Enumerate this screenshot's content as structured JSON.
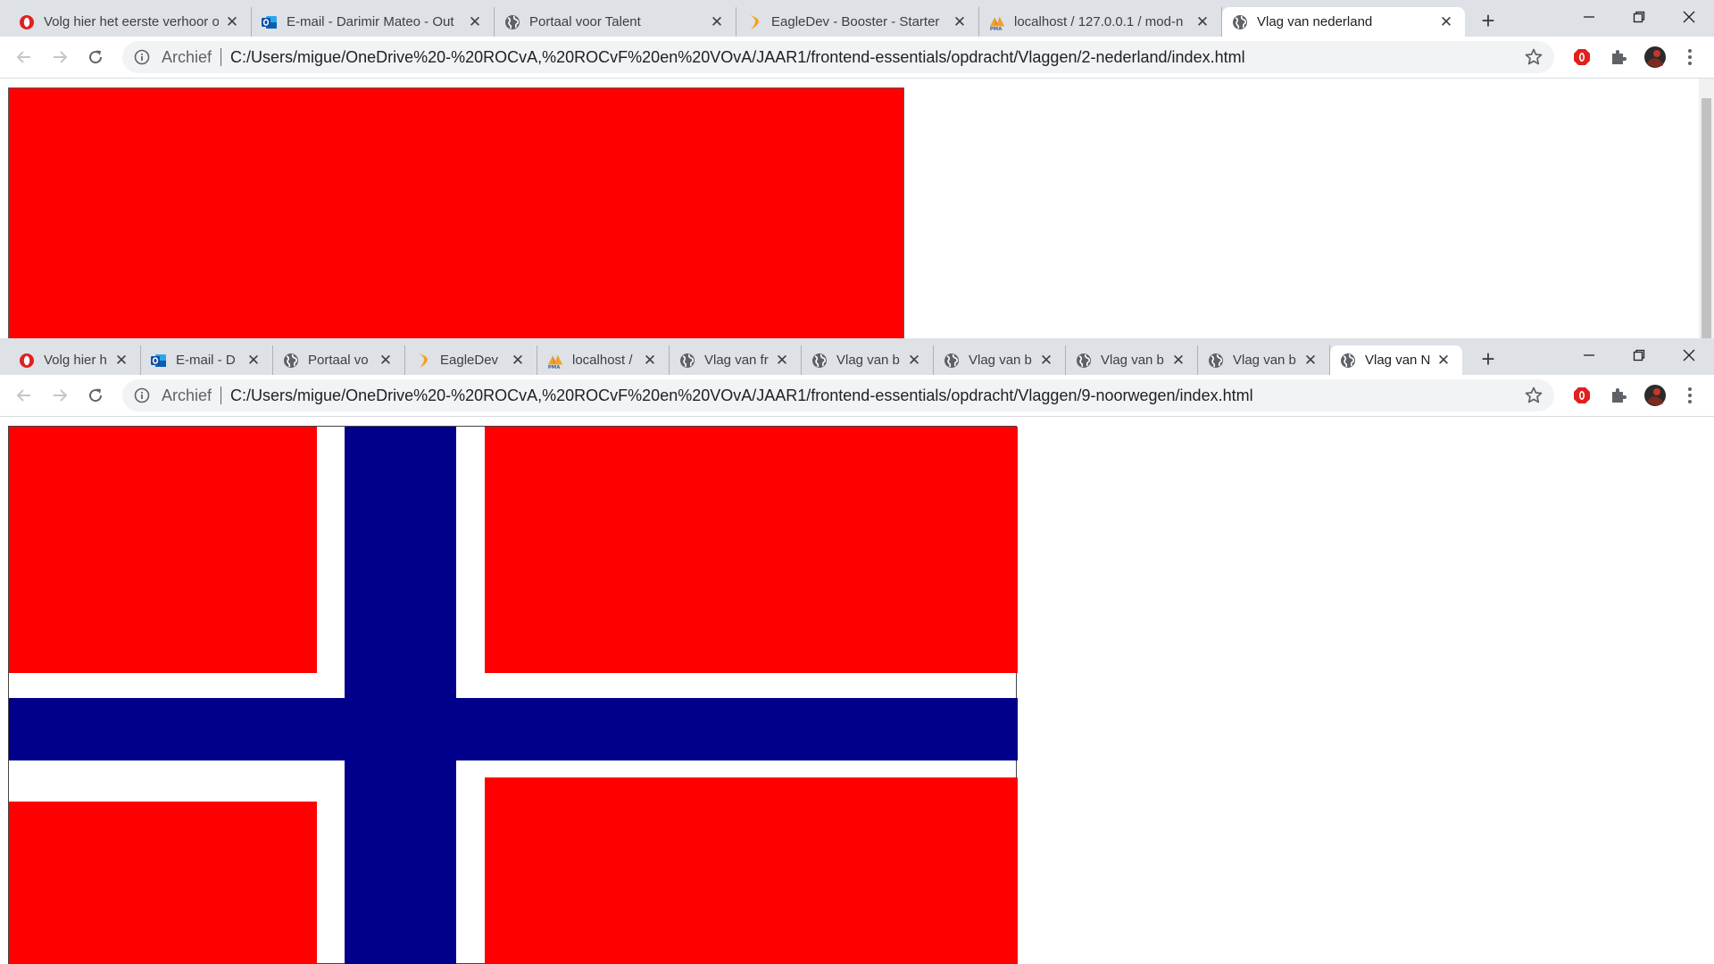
{
  "colors": {
    "red": "#ff0000",
    "blue": "#00008b",
    "white": "#ffffff",
    "tabstrip": "#dee1e6"
  },
  "icons": {
    "tab_opera": "opera-icon",
    "tab_outlook": "outlook-icon",
    "tab_globe": "globe-icon",
    "tab_eagledev": "eagledev-icon",
    "tab_pma": "phpmyadmin-icon",
    "back": "arrow-left-icon",
    "forward": "arrow-right-icon",
    "reload": "reload-icon",
    "info": "info-icon",
    "star": "star-icon",
    "opera_ext": "opera-extension-icon",
    "puzzle": "puzzle-icon",
    "avatar": "avatar-icon",
    "menu": "kebab-menu-icon"
  },
  "window_top": {
    "tabs": [
      {
        "title": "Volg hier het eerste verhoor o",
        "icon": "opera-icon"
      },
      {
        "title": "E-mail - Darimir Mateo - Out",
        "icon": "outlook-icon"
      },
      {
        "title": "Portaal voor Talent",
        "icon": "globe-icon"
      },
      {
        "title": "EagleDev - Booster - Starter",
        "icon": "eagledev-icon"
      },
      {
        "title": "localhost / 127.0.0.1 / mod-n",
        "icon": "phpmyadmin-icon"
      },
      {
        "title": "Vlag van nederland",
        "icon": "globe-icon",
        "active": true
      }
    ],
    "address": {
      "badge": "Archief",
      "url": "C:/Users/migue/OneDrive%20-%20ROCvA,%20ROCvF%20en%20VOvA/JAAR1/frontend-essentials/opdracht/Vlaggen/2-nederland/index.html"
    }
  },
  "window_bottom": {
    "tabs": [
      {
        "title": "Volg hier h",
        "icon": "opera-icon"
      },
      {
        "title": "E-mail - D",
        "icon": "outlook-icon"
      },
      {
        "title": "Portaal vo",
        "icon": "globe-icon"
      },
      {
        "title": "EagleDev",
        "icon": "eagledev-icon"
      },
      {
        "title": "localhost /",
        "icon": "phpmyadmin-icon"
      },
      {
        "title": "Vlag van fr",
        "icon": "globe-icon"
      },
      {
        "title": "Vlag van b",
        "icon": "globe-icon"
      },
      {
        "title": "Vlag van b",
        "icon": "globe-icon"
      },
      {
        "title": "Vlag van b",
        "icon": "globe-icon"
      },
      {
        "title": "Vlag van b",
        "icon": "globe-icon"
      },
      {
        "title": "Vlag van N",
        "icon": "globe-icon",
        "active": true
      }
    ],
    "address": {
      "badge": "Archief",
      "url": "C:/Users/migue/OneDrive%20-%20ROCvA,%20ROCvF%20en%20VOvA/JAAR1/frontend-essentials/opdracht/Vlaggen/9-noorwegen/index.html"
    }
  }
}
